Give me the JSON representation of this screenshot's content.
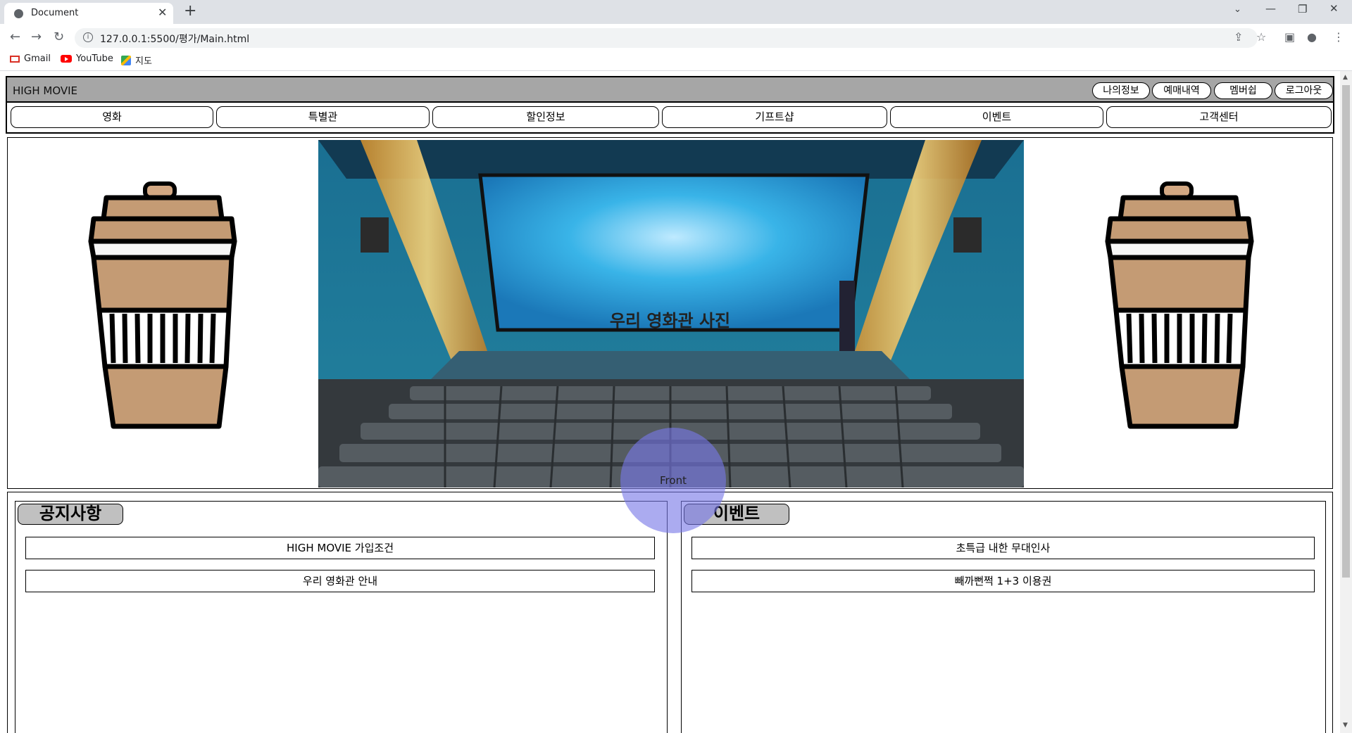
{
  "browser": {
    "tab_title": "Document",
    "url": "127.0.0.1:5500/평가/Main.html",
    "bookmarks": [
      "Gmail",
      "YouTube",
      "지도"
    ]
  },
  "header": {
    "brand": "HIGH MOVIE",
    "user_menu": [
      "나의정보",
      "예매내역",
      "멤버쉽",
      "로그아웃"
    ],
    "nav": [
      "영화",
      "특별관",
      "할인정보",
      "기프트샵",
      "이벤트",
      "고객센터"
    ]
  },
  "hero": {
    "caption": "우리 영화관 사진"
  },
  "notice": {
    "title": "공지사항",
    "items": [
      "HIGH MOVIE 가입조건",
      "우리 영화관 안내"
    ]
  },
  "event": {
    "title": "이벤트",
    "items": [
      "초특급 내한 무대인사",
      "빼까뻔쩍 1+3 이용권"
    ]
  },
  "overlay": {
    "label": "Front"
  },
  "colors": {
    "topbar": "#a6a6a6",
    "panel_title_bg": "#c0c0c0",
    "overlay": "#7878e6",
    "screen": "#2ba6d9"
  }
}
